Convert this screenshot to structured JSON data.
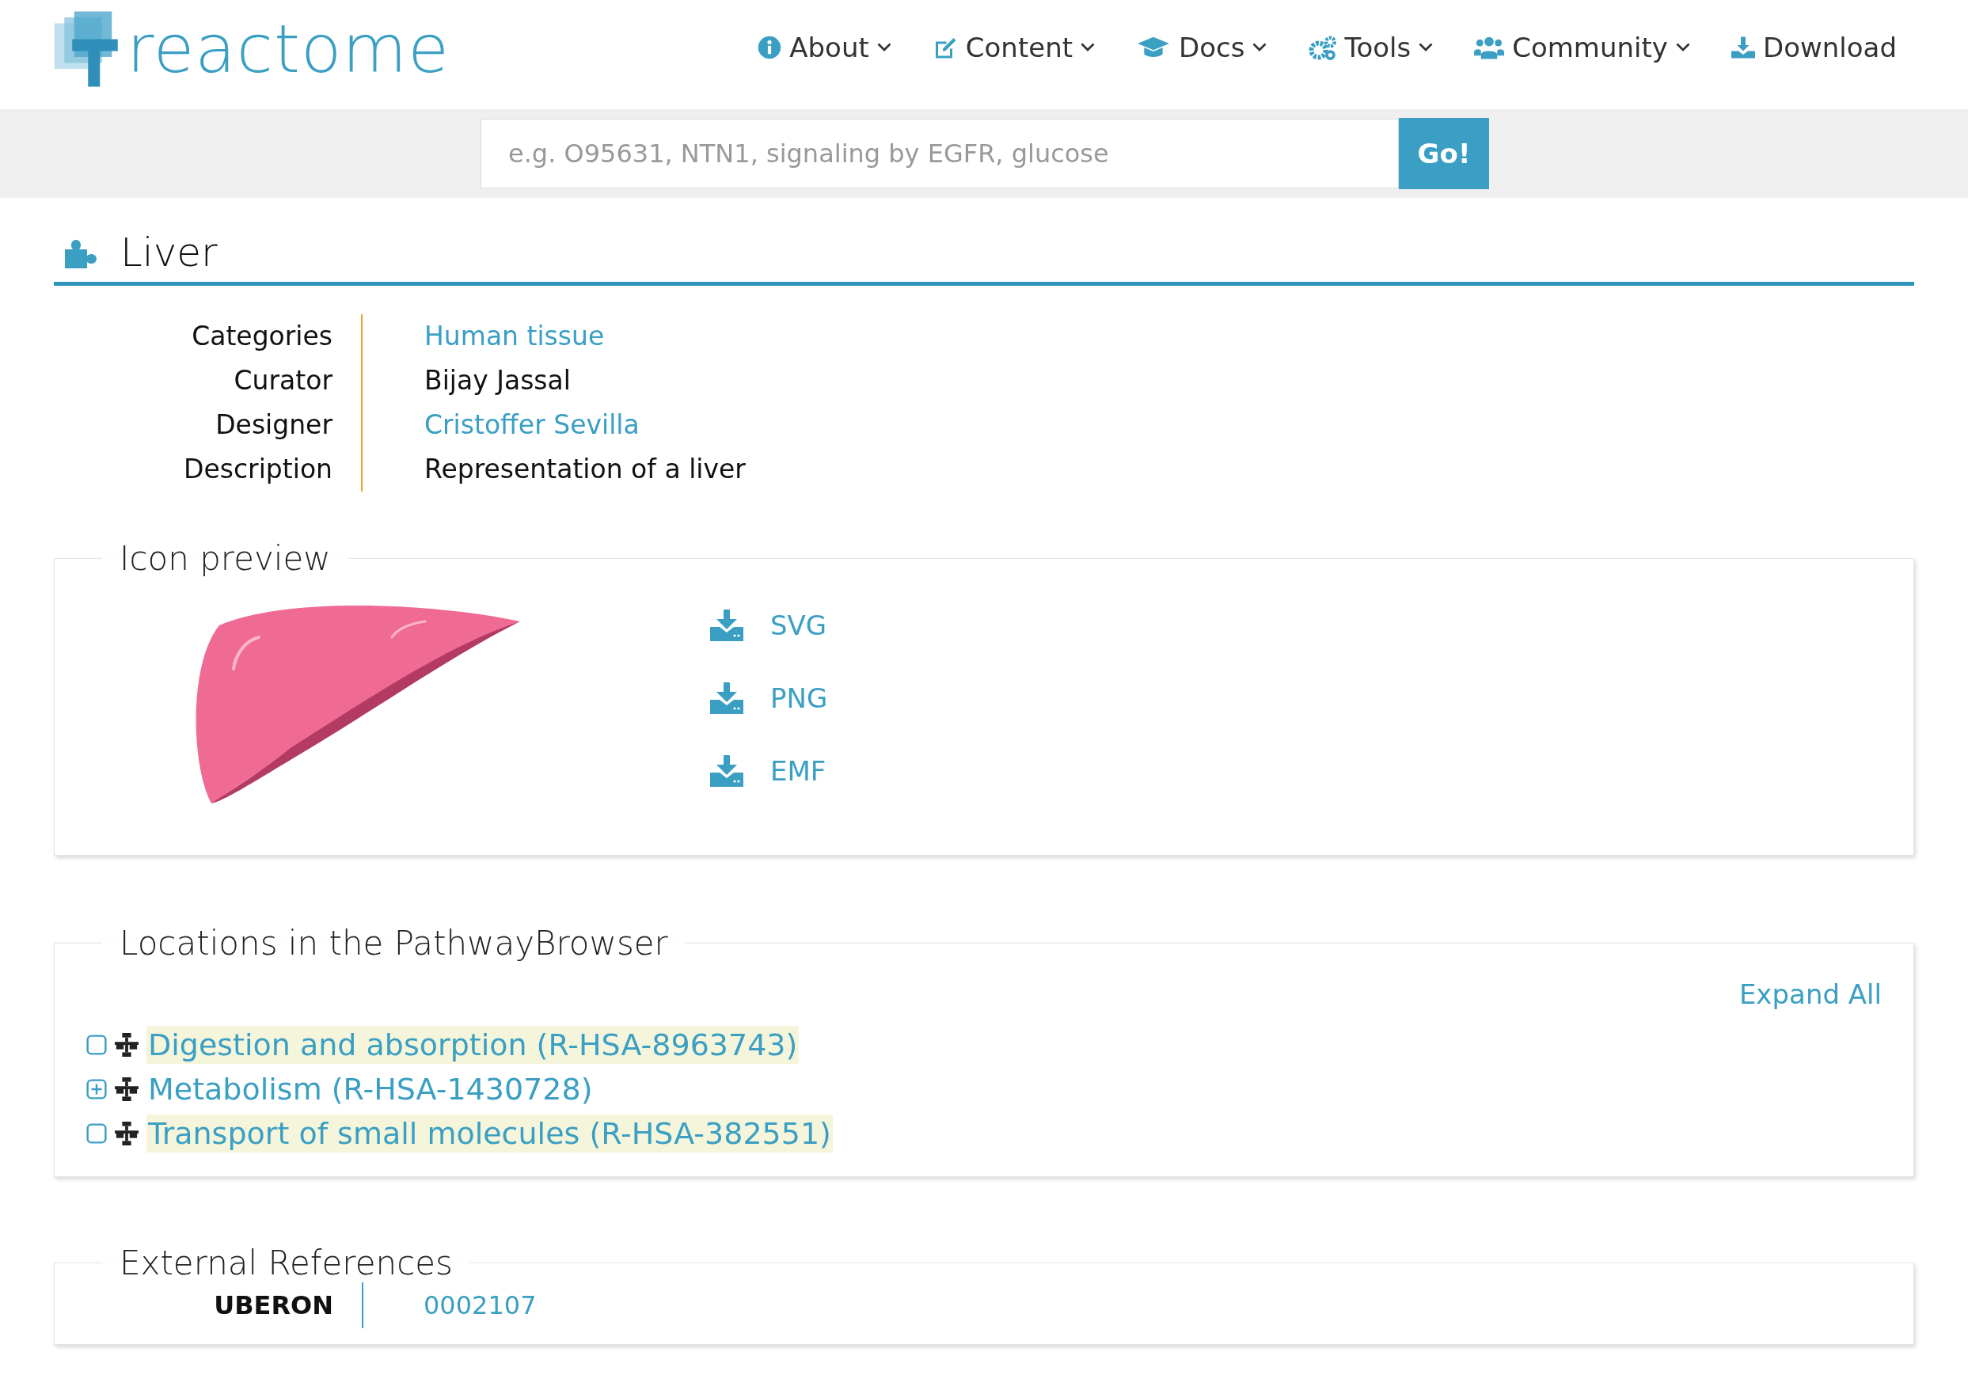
{
  "header": {
    "logo": "reactome",
    "nav": [
      {
        "label": "About",
        "kind": "info",
        "dropdown": true
      },
      {
        "label": "Content",
        "kind": "edit",
        "dropdown": true
      },
      {
        "label": "Docs",
        "kind": "cap",
        "dropdown": true
      },
      {
        "label": "Tools",
        "kind": "gears",
        "dropdown": true
      },
      {
        "label": "Community",
        "kind": "people",
        "dropdown": true
      },
      {
        "label": "Download",
        "kind": "download",
        "dropdown": false
      }
    ]
  },
  "search": {
    "placeholder": "e.g. O95631, NTN1, signaling by EGFR, glucose",
    "button": "Go!"
  },
  "title": "Liver",
  "details": [
    {
      "label": "Categories",
      "value": "Human tissue",
      "link": true
    },
    {
      "label": "Curator",
      "value": "Bijay Jassal",
      "link": false
    },
    {
      "label": "Designer",
      "value": "Cristoffer Sevilla",
      "link": true
    },
    {
      "label": "Description",
      "value": "Representation of a liver",
      "link": false
    }
  ],
  "icon_preview": {
    "legend": "Icon preview",
    "downloads": [
      "SVG",
      "PNG",
      "EMF"
    ]
  },
  "locations": {
    "legend": "Locations in the PathwayBrowser",
    "expand_all": "Expand All",
    "items": [
      {
        "label": "Digestion and absorption (R-HSA-8963743)",
        "kind": "leaf",
        "highlighted": true
      },
      {
        "label": "Metabolism (R-HSA-1430728)",
        "kind": "collapsed",
        "highlighted": false
      },
      {
        "label": "Transport of small molecules (R-HSA-382551)",
        "kind": "leaf",
        "highlighted": true
      }
    ]
  },
  "external_references": {
    "legend": "External References",
    "rows": [
      {
        "label": "UBERON",
        "value": "0002107"
      }
    ]
  }
}
